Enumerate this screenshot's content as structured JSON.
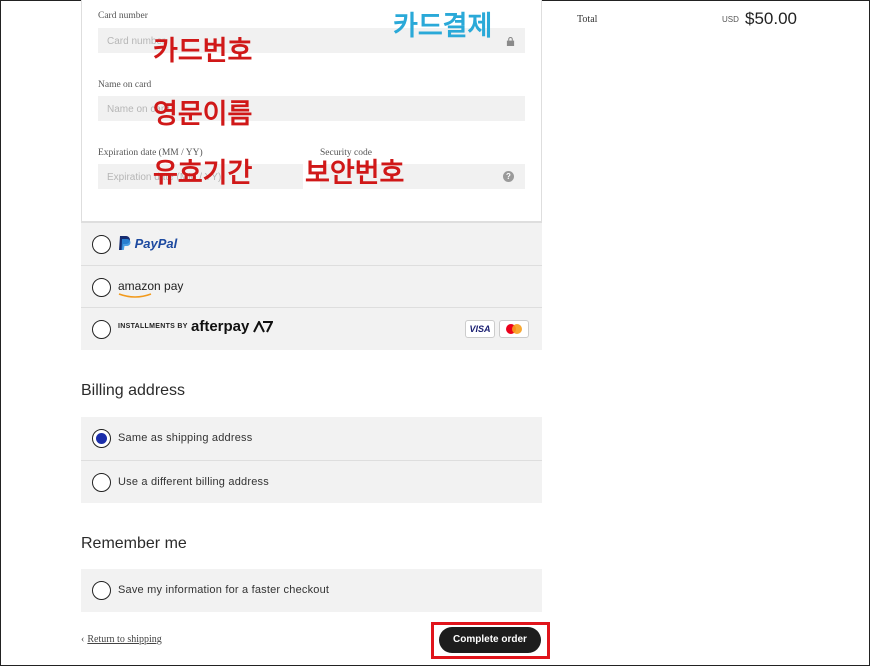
{
  "card_form": {
    "card_number_label": "Card number",
    "card_number_placeholder": "Card number",
    "name_label": "Name on card",
    "name_placeholder": "Name on card",
    "expiration_label": "Expiration date (MM / YY)",
    "expiration_placeholder": "Expiration date (MM / YY)",
    "security_label": "Security code",
    "help_glyph": "?"
  },
  "annotations": {
    "card_payment": "카드결제",
    "card_number": "카드번호",
    "name_english": "영문이름",
    "expiration": "유효기간",
    "security_code": "보안번호",
    "red_color": "#d01818",
    "blue_color": "#2aa9d8"
  },
  "payment_methods": [
    {
      "name": "PayPal",
      "icon": "paypal-logo"
    },
    {
      "name": "amazon pay",
      "icon": "amazon-pay-logo"
    },
    {
      "prefix": "INSTALLMENTS BY",
      "name": "afterpay",
      "icon": "afterpay-logo"
    }
  ],
  "card_badges": [
    "VISA",
    "mastercard-icon"
  ],
  "billing": {
    "title": "Billing address",
    "options": [
      "Same as shipping address",
      "Use a different billing address"
    ]
  },
  "remember": {
    "title": "Remember me",
    "option": "Save my information for a faster checkout"
  },
  "footer": {
    "return_label": "Return to shipping",
    "complete_label": "Complete order",
    "accent": "#1d1d1d",
    "highlight_color": "#e0141b"
  },
  "summary": {
    "total_label": "Total",
    "currency": "USD",
    "amount": "$50.00"
  }
}
